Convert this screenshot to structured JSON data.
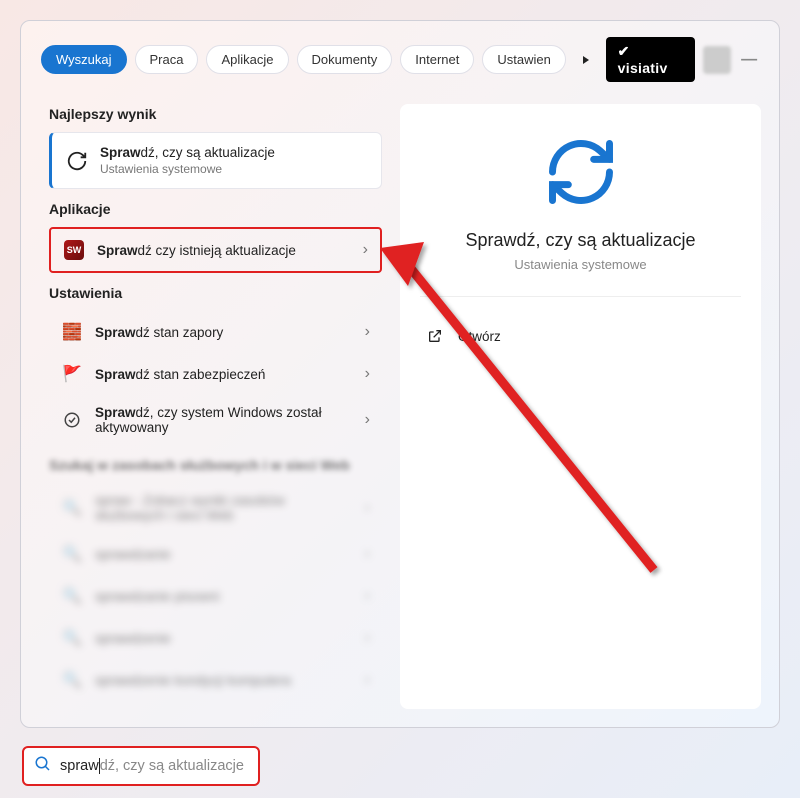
{
  "tabs": {
    "search": "Wyszukaj",
    "work": "Praca",
    "apps": "Aplikacje",
    "docs": "Dokumenty",
    "internet": "Internet",
    "settings": "Ustawien"
  },
  "brand": "✔ visiativ",
  "sections": {
    "best": "Najlepszy wynik",
    "apps": "Aplikacje",
    "settings": "Ustawienia",
    "web_header": "Szukaj w zasobach służbowych i w sieci Web"
  },
  "best": {
    "prefix": "Spraw",
    "rest": "dź, czy są aktualizacje",
    "sub": "Ustawienia systemowe"
  },
  "apps_items": [
    {
      "prefix": "Spraw",
      "rest": "dź czy istnieją aktualizacje"
    }
  ],
  "settings_items": [
    {
      "prefix": "Spraw",
      "rest": "dź stan zapory"
    },
    {
      "prefix": "Spraw",
      "rest": "dź stan zabezpieczeń"
    },
    {
      "prefix": "Spraw",
      "rest": "dź, czy system Windows został aktywowany"
    }
  ],
  "web_items": [
    {
      "text": "spraw - Zobacz wyniki zasobów służbowych i sieci Web"
    },
    {
      "text": "sprawdzanie"
    },
    {
      "text": "sprawdzanie pisowni"
    },
    {
      "text": "sprawdzenie"
    },
    {
      "text": "sprawdzenie kondycji komputera"
    }
  ],
  "preview": {
    "title": "Sprawdź, czy są aktualizacje",
    "sub": "Ustawienia systemowe",
    "open": "Otwórz"
  },
  "searchbar": {
    "typed": "spraw",
    "rest": "dź, czy są aktualizacje"
  }
}
